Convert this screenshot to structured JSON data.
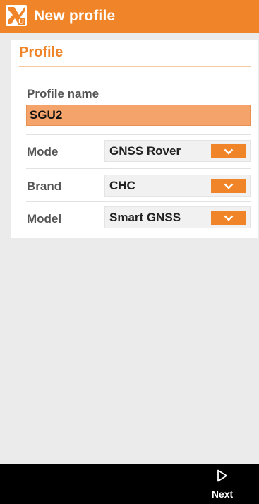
{
  "appbar": {
    "title": "New profile",
    "logo_icon": "app-logo-icon",
    "color": "#f08428"
  },
  "profile": {
    "section_title": "Profile",
    "name_label": "Profile name",
    "name_value": "SGU2",
    "fields": [
      {
        "label": "Mode",
        "value": "GNSS Rover"
      },
      {
        "label": "Brand",
        "value": "CHC"
      },
      {
        "label": "Model",
        "value": "Smart GNSS"
      }
    ]
  },
  "footer": {
    "next_label": "Next",
    "next_icon": "play-triangle-outline-icon"
  }
}
